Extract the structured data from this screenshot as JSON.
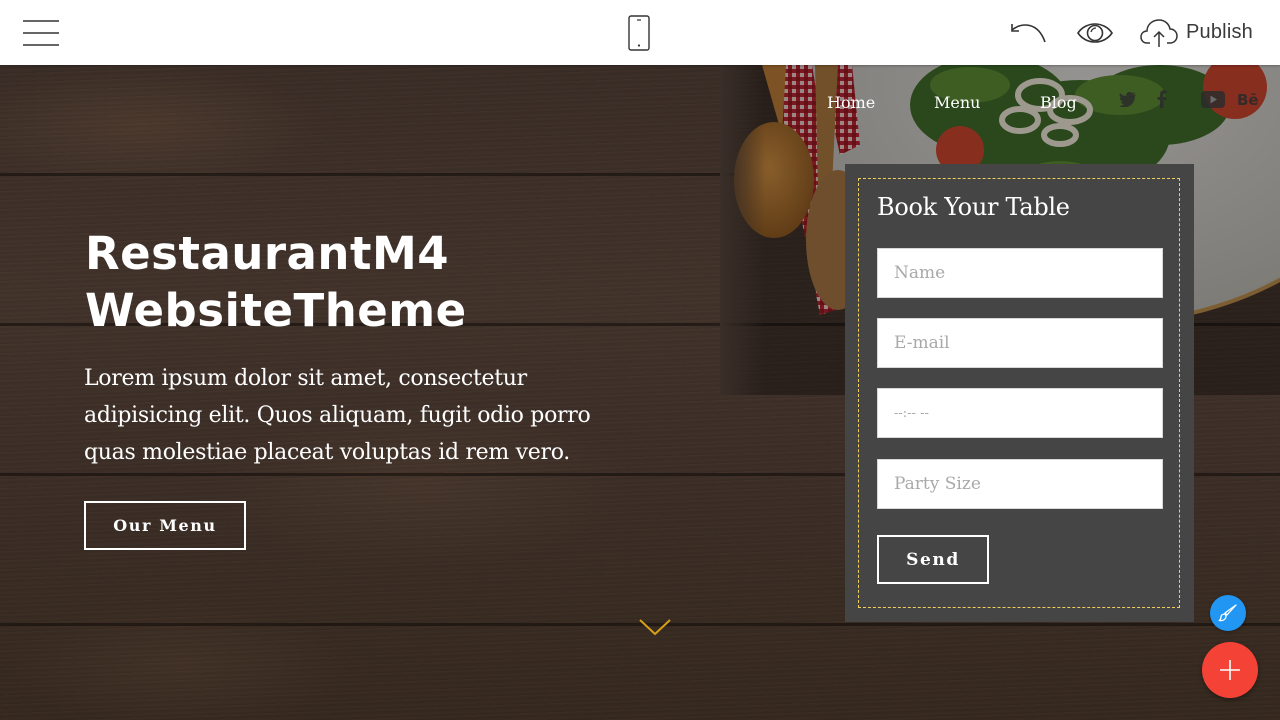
{
  "toolbar": {
    "menu_icon": "hamburger-icon",
    "device_icon": "mobile-phone-icon",
    "undo_icon": "undo-icon",
    "preview_icon": "eye-icon",
    "publish_icon": "cloud-upload-icon",
    "publish_label": "Publish"
  },
  "nav": {
    "items": [
      {
        "label": "Home"
      },
      {
        "label": "Menu"
      },
      {
        "label": "Blog"
      }
    ],
    "social_icons": [
      "twitter-icon",
      "facebook-icon",
      "youtube-icon",
      "behance-icon"
    ]
  },
  "hero": {
    "title_line1": "RestaurantM4",
    "title_line2": "WebsiteTheme",
    "text": "Lorem ipsum dolor sit amet, consectetur adipisicing elit. Quos aliquam, fugit odio porro quas molestiae placeat voluptas id rem vero.",
    "button_label": "Our Menu",
    "scroll_icon": "chevron-down-icon"
  },
  "booking_form": {
    "title": "Book Your Table",
    "fields": {
      "name": {
        "placeholder": "Name",
        "value": ""
      },
      "email": {
        "placeholder": "E-mail",
        "value": ""
      },
      "time": {
        "placeholder": "--:-- --",
        "value": ""
      },
      "party_size": {
        "placeholder": "Party Size",
        "value": ""
      }
    },
    "submit_label": "Send"
  },
  "fabs": {
    "edit_icon": "paintbrush-icon",
    "add_icon": "plus-icon"
  },
  "colors": {
    "accent_dashed_border": "#f2cf5b",
    "form_background": "#454545",
    "edit_fab": "#2196f3",
    "add_fab": "#f44336",
    "scroll_arrow": "#d4a017"
  }
}
